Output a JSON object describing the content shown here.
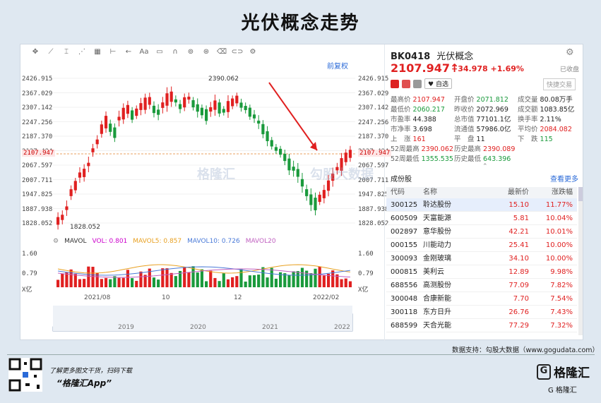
{
  "page": {
    "title": "光伏概念走势"
  },
  "toolbar": {
    "items": [
      "✥",
      "⟋",
      "⌶",
      "⋰",
      "▦",
      "⊢",
      "←",
      "Aa",
      "▭",
      "∩",
      "⊚",
      "⊛",
      "⌫",
      "⊂⊃",
      "⚙"
    ]
  },
  "chart": {
    "restore_label": "前复权",
    "y_labels": [
      "2426.915",
      "2367.029",
      "2307.142",
      "2247.256",
      "2187.370",
      "2127.484",
      "2067.597",
      "2007.711",
      "1947.825",
      "1887.938",
      "1828.052"
    ],
    "current_tag": "2107.947",
    "high_annot": "2390.062",
    "low_annot": "1828.052",
    "vol_y_labels": [
      "1.60",
      "0.79",
      "X亿"
    ],
    "indicators": {
      "name": "MAVOL",
      "vol": "VOL: 0.801",
      "ma5": "MAVOL5: 0.857",
      "ma10": "MAVOL10: 0.726",
      "ma20": "MAVOL20"
    },
    "x_labels": [
      "2021/08",
      "10",
      "12",
      "2022/02"
    ],
    "nav_labels": [
      "2019",
      "2020",
      "2021",
      "2022"
    ],
    "colors": {
      "up": "#e02020",
      "down": "#1a9a3c",
      "ma5": "#e8a020",
      "ma10": "#4a7ad8",
      "ma20": "#c060c0"
    }
  },
  "watermark": {
    "left": "格隆汇",
    "right": "勾股大数据"
  },
  "info": {
    "code": "BK0418",
    "name": "光伏概念",
    "fav": "已收盘",
    "price": "2107.947",
    "change": "+34.978",
    "change_pct": "+1.69%",
    "zixuan": "自选",
    "quick": "快捷交易",
    "stats": [
      [
        [
          "最高价",
          "2107.947",
          "red"
        ],
        [
          "开盘价",
          "2071.812",
          "grn"
        ],
        [
          "成交量",
          "80.08万手",
          "blk"
        ]
      ],
      [
        [
          "最低价",
          "2060.217",
          "grn"
        ],
        [
          "昨收价",
          "2072.969",
          "blk"
        ],
        [
          "成交额",
          "1083.85亿",
          "blk"
        ]
      ],
      [
        [
          "市盈率",
          "44.388",
          "blk"
        ],
        [
          "总市值",
          "77101.1亿",
          "blk"
        ],
        [
          "换手率",
          "2.11%",
          "blk"
        ]
      ],
      [
        [
          "市净率",
          "3.698",
          "blk"
        ],
        [
          "流通值",
          "57986.0亿",
          "blk"
        ],
        [
          "平均价",
          "2084.082",
          "red"
        ]
      ],
      [
        [
          "上　涨",
          "161",
          "red"
        ],
        [
          "平　盘",
          "11",
          "blk"
        ],
        [
          "下　跌",
          "115",
          "grn"
        ]
      ],
      [
        [
          "52周最高",
          "2390.062",
          "red"
        ],
        [
          "历史最高",
          "2390.089",
          "red"
        ],
        [
          "",
          "",
          "blk"
        ]
      ],
      [
        [
          "52周最低",
          "1355.535",
          "grn"
        ],
        [
          "历史最低",
          "643.396",
          "grn"
        ],
        [
          "",
          "",
          "blk"
        ]
      ]
    ],
    "list_title": "成份股",
    "more": "查看更多",
    "headers": [
      "代码",
      "名称",
      "最新价",
      "涨跌幅"
    ],
    "rows": [
      [
        "300125",
        "聆达股份",
        "15.10",
        "11.77%"
      ],
      [
        "600509",
        "天富能源",
        "5.81",
        "10.04%"
      ],
      [
        "002897",
        "意华股份",
        "42.21",
        "10.01%"
      ],
      [
        "000155",
        "川能动力",
        "25.41",
        "10.00%"
      ],
      [
        "300093",
        "金刚玻璃",
        "34.10",
        "10.00%"
      ],
      [
        "000815",
        "美利云",
        "12.89",
        "9.98%"
      ],
      [
        "688556",
        "高测股份",
        "77.09",
        "7.82%"
      ],
      [
        "300048",
        "合康新能",
        "7.70",
        "7.54%"
      ],
      [
        "300118",
        "东方日升",
        "26.76",
        "7.43%"
      ],
      [
        "688599",
        "天合光能",
        "77.29",
        "7.32%"
      ]
    ]
  },
  "footer": {
    "source": "数据支持：勾股大数据（www.gogudata.com）",
    "learn": "了解更多图文干货，扫码下载",
    "app": "“格隆汇App”",
    "logo_mark": "G",
    "logo_text": "格隆汇",
    "brand": "G 格隆汇"
  }
}
